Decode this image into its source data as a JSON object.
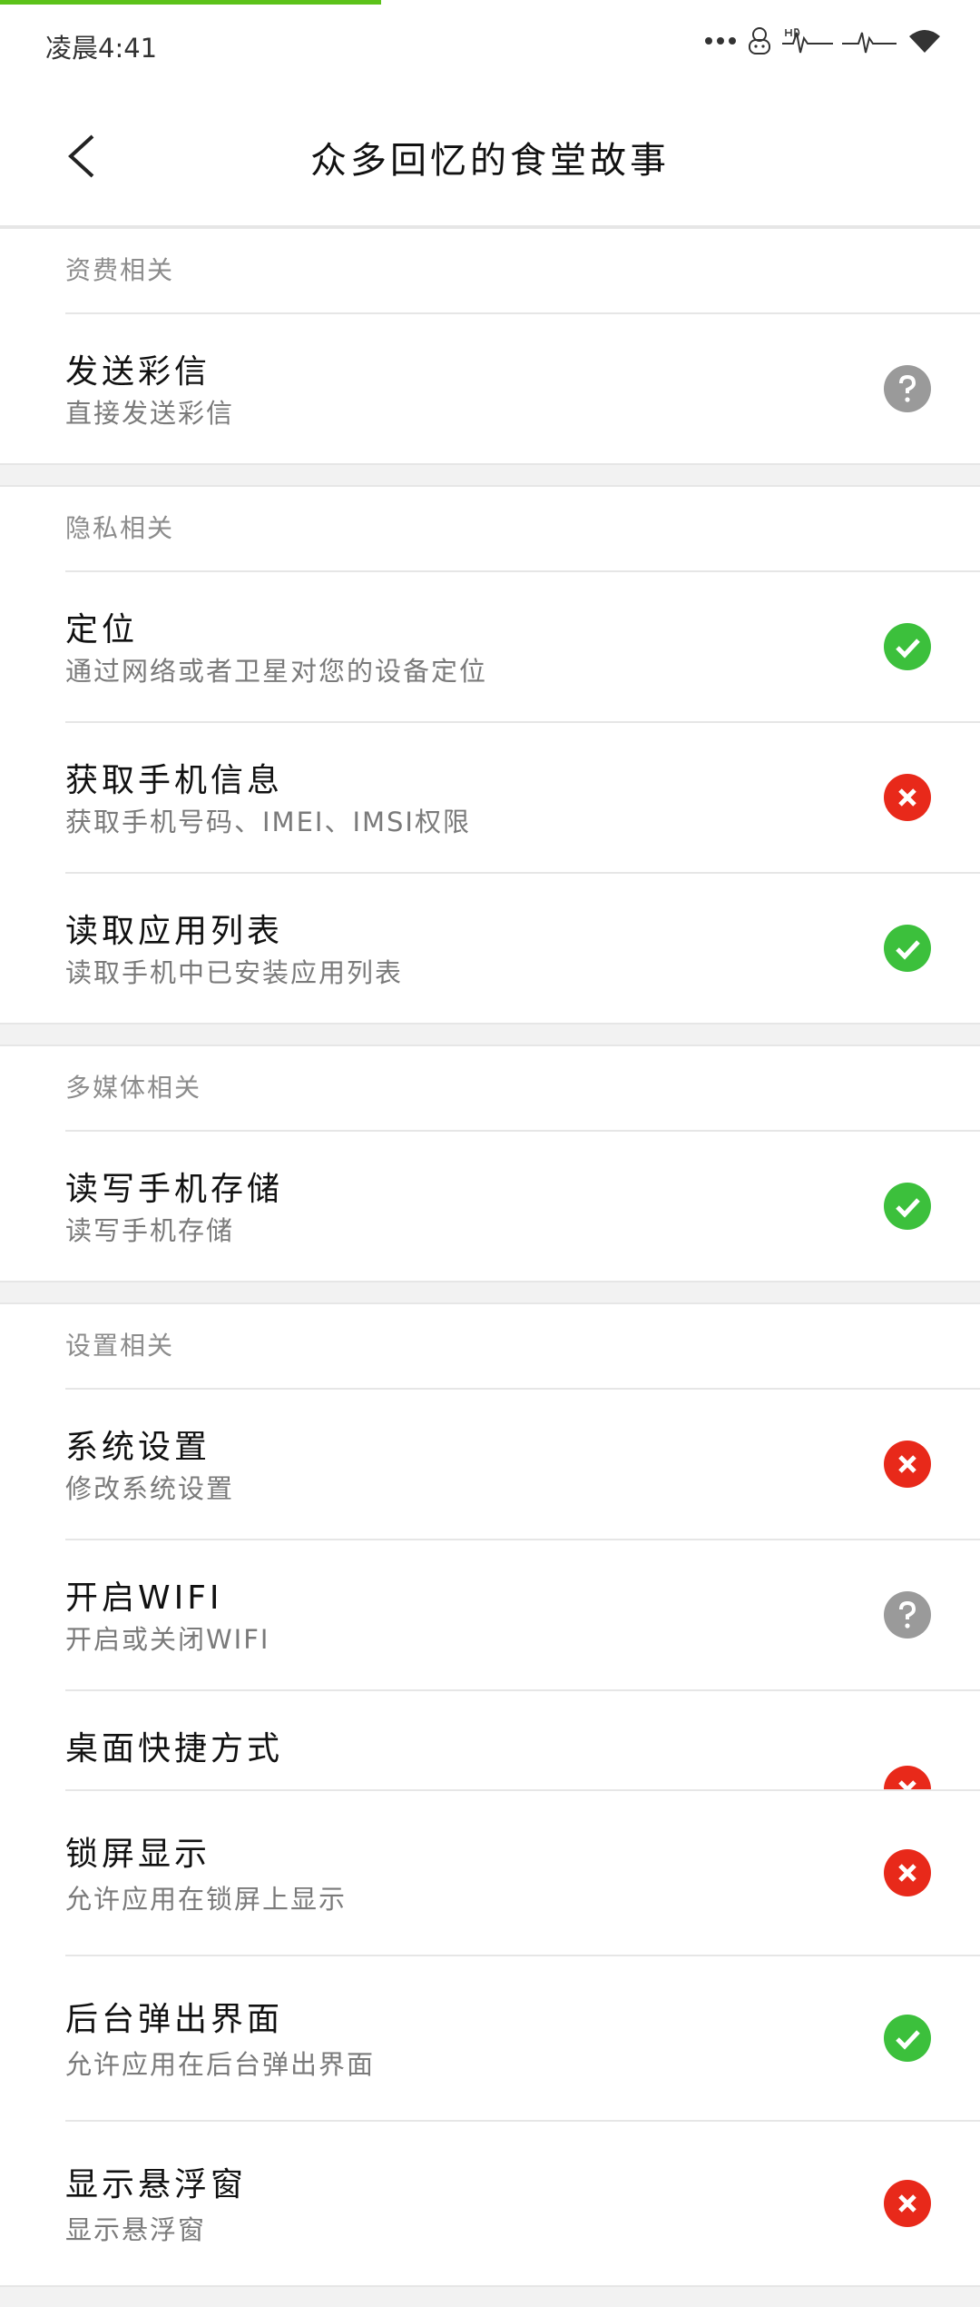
{
  "status_bar": {
    "time": "凌晨4:41"
  },
  "header": {
    "title": "众多回忆的食堂故事"
  },
  "colors": {
    "allowed": "#3cc03c",
    "denied": "#e8291a",
    "ask": "#9a9a9a",
    "progress": "#5cc21a"
  },
  "sections": [
    {
      "title": "资费相关",
      "items": [
        {
          "title": "发送彩信",
          "desc": "直接发送彩信",
          "status": "ask",
          "icon": "question-circle-icon"
        }
      ]
    },
    {
      "title": "隐私相关",
      "items": [
        {
          "title": "定位",
          "desc": "通过网络或者卫星对您的设备定位",
          "status": "allowed",
          "icon": "check-circle-icon"
        },
        {
          "title": "获取手机信息",
          "desc": "获取手机号码、IMEI、IMSI权限",
          "status": "denied",
          "icon": "x-circle-icon"
        },
        {
          "title": "读取应用列表",
          "desc": "读取手机中已安装应用列表",
          "status": "allowed",
          "icon": "check-circle-icon"
        }
      ]
    },
    {
      "title": "多媒体相关",
      "items": [
        {
          "title": "读写手机存储",
          "desc": "读写手机存储",
          "status": "allowed",
          "icon": "check-circle-icon"
        }
      ]
    },
    {
      "title": "设置相关",
      "items": [
        {
          "title": "系统设置",
          "desc": "修改系统设置",
          "status": "denied",
          "icon": "x-circle-icon"
        },
        {
          "title": "开启WIFI",
          "desc": "开启或关闭WIFI",
          "status": "ask",
          "icon": "question-circle-icon"
        },
        {
          "title": "桌面快捷方式",
          "desc": "",
          "status": "denied",
          "icon": "x-circle-icon"
        },
        {
          "title": "锁屏显示",
          "desc": "允许应用在锁屏上显示",
          "status": "denied",
          "icon": "x-circle-icon"
        },
        {
          "title": "后台弹出界面",
          "desc": "允许应用在后台弹出界面",
          "status": "allowed",
          "icon": "check-circle-icon"
        },
        {
          "title": "显示悬浮窗",
          "desc": "显示悬浮窗",
          "status": "denied",
          "icon": "x-circle-icon"
        }
      ]
    }
  ]
}
